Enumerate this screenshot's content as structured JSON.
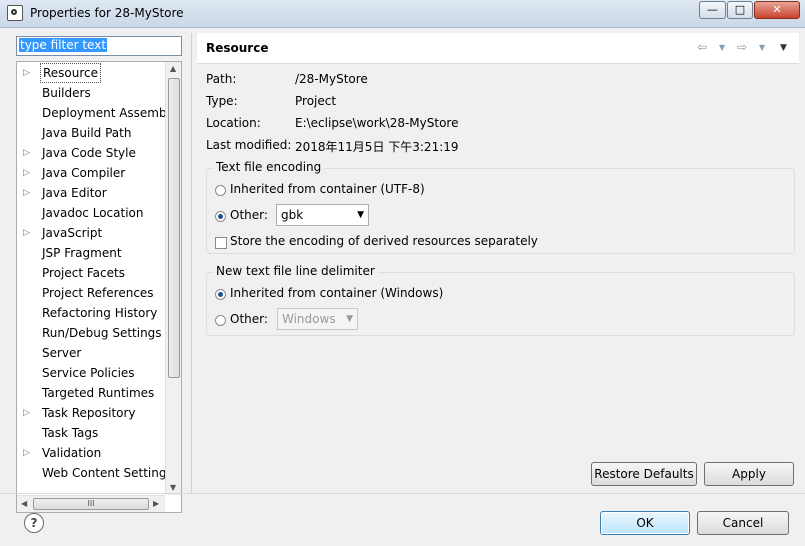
{
  "window": {
    "title": "Properties for 28-MyStore",
    "min_glyph": "—",
    "max_glyph": "□",
    "close_glyph": "✕"
  },
  "filter": {
    "placeholder": "type filter text"
  },
  "tree": {
    "items": [
      {
        "label": "Resource",
        "expandable": true,
        "selected": true
      },
      {
        "label": "Builders",
        "expandable": false
      },
      {
        "label": "Deployment Assembly",
        "expandable": false
      },
      {
        "label": "Java Build Path",
        "expandable": false
      },
      {
        "label": "Java Code Style",
        "expandable": true
      },
      {
        "label": "Java Compiler",
        "expandable": true
      },
      {
        "label": "Java Editor",
        "expandable": true
      },
      {
        "label": "Javadoc Location",
        "expandable": false
      },
      {
        "label": "JavaScript",
        "expandable": true
      },
      {
        "label": "JSP Fragment",
        "expandable": false
      },
      {
        "label": "Project Facets",
        "expandable": false
      },
      {
        "label": "Project References",
        "expandable": false
      },
      {
        "label": "Refactoring History",
        "expandable": false
      },
      {
        "label": "Run/Debug Settings",
        "expandable": false
      },
      {
        "label": "Server",
        "expandable": false
      },
      {
        "label": "Service Policies",
        "expandable": false
      },
      {
        "label": "Targeted Runtimes",
        "expandable": false
      },
      {
        "label": "Task Repository",
        "expandable": true
      },
      {
        "label": "Task Tags",
        "expandable": false
      },
      {
        "label": "Validation",
        "expandable": true
      },
      {
        "label": "Web Content Settings",
        "expandable": false
      }
    ],
    "hscroll_grip": "III"
  },
  "page": {
    "title": "Resource",
    "properties": [
      {
        "key": "Path:",
        "value": "/28-MyStore"
      },
      {
        "key": "Type:",
        "value": "Project"
      },
      {
        "key": "Location:",
        "value": "E:\\eclipse\\work\\28-MyStore"
      },
      {
        "key": "Last modified:",
        "value": "2018年11月5日 下午3:21:19"
      }
    ],
    "encoding": {
      "legend": "Text file encoding",
      "inherited_label": "Inherited from container (UTF-8)",
      "other_label": "Other:",
      "other_value": "gbk",
      "selected": "other",
      "derived_label": "Store the encoding of derived resources separately",
      "derived_checked": false
    },
    "delimiter": {
      "legend": "New text file line delimiter",
      "inherited_label": "Inherited from container (Windows)",
      "other_label": "Other:",
      "other_value": "Windows",
      "selected": "inherited"
    },
    "restore_defaults": "Restore Defaults",
    "apply": "Apply"
  },
  "footer": {
    "help": "?",
    "ok": "OK",
    "cancel": "Cancel"
  }
}
